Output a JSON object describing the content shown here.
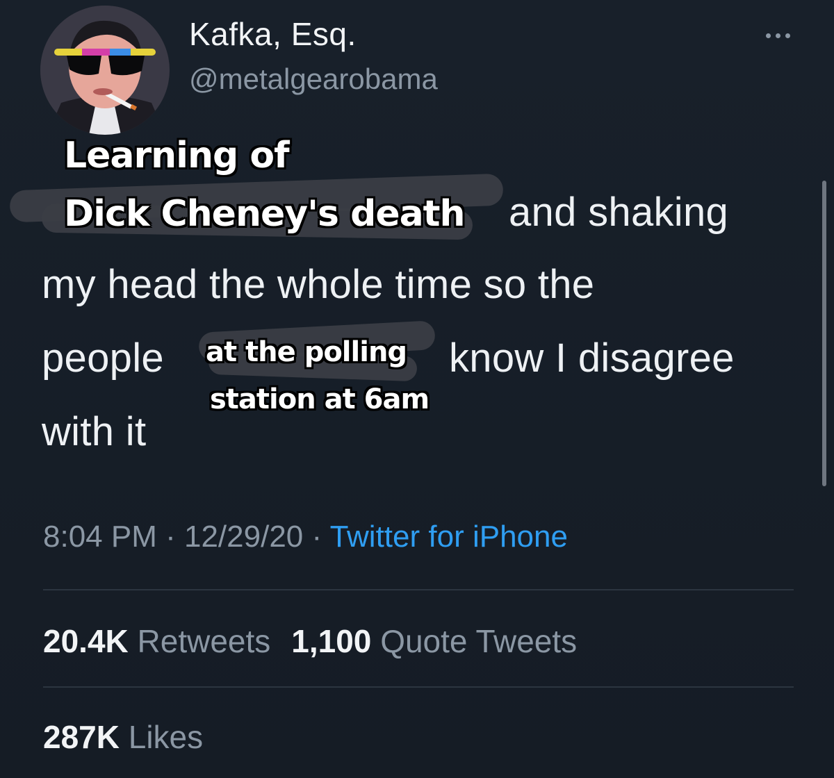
{
  "author": {
    "display_name": "Kafka, Esq.",
    "handle": "@metalgearobama"
  },
  "tweet": {
    "captions": {
      "top_line1": "Learning of",
      "top_line2": "Dick Cheney's death",
      "mid_line1": "at the polling",
      "mid_line2": "station at 6am"
    },
    "text_line1": "and shaking",
    "text_line2": "my head the whole time so the",
    "text_line3_a": "people",
    "text_line3_b": "know I disagree",
    "text_line4": "with it"
  },
  "meta": {
    "time": "8:04 PM",
    "sep1": " · ",
    "date": "12/29/20",
    "sep2": " · ",
    "source": "Twitter for iPhone"
  },
  "stats": {
    "retweets_count": "20.4K",
    "retweets_label": "Retweets",
    "quotes_count": "1,100",
    "quotes_label": "Quote Tweets",
    "likes_count": "287K",
    "likes_label": "Likes"
  },
  "colors": {
    "background": "#161d26",
    "link": "#2f9ef2",
    "secondary_text": "#8b97a4"
  },
  "icons": {
    "more": "more-horizontal-icon"
  }
}
